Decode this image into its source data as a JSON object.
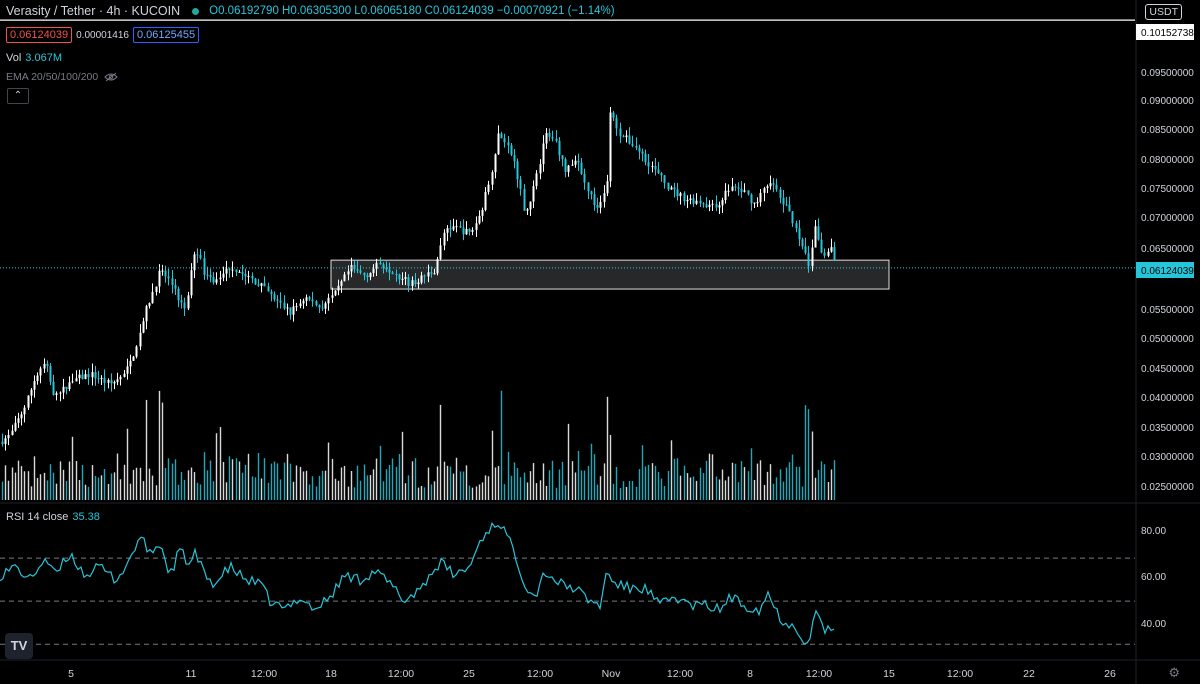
{
  "header": {
    "symbol": "Verasity / Tether · 4h · KUCOIN",
    "ohlc_text": "O0.06192790 H0.06305300 L0.06065180 C0.06124039 −0.00070921 (−1.14%)",
    "sell_price": "0.06124039",
    "spread": "0.00001416",
    "buy_price": "0.06125455",
    "vol_label": "Vol",
    "vol_value": "3.067M",
    "ema_label": "EMA 20/50/100/200",
    "rsi_label": "RSI 14 close",
    "rsi_value": "35.38",
    "currency_button": "USDT",
    "collapse_icon": "chevron-up-icon",
    "logo_text": "TV"
  },
  "colors": {
    "background": "#000000",
    "candle_up": "#ffffff",
    "candle_down": "#26c6da",
    "volume": "#ffffff",
    "rsi_line": "#26c6da",
    "current_price_tag": "#26c6da",
    "box_fill": "#b2b5be",
    "text": "#d1d4dc"
  },
  "chart_data": [
    {
      "type": "candlestick",
      "title": "Verasity / Tether · 4h · KUCOIN",
      "y_axis_labels": [
        "0.10152738",
        "0.09500000",
        "0.09000000",
        "0.08500000",
        "0.08000000",
        "0.07500000",
        "0.07000000",
        "0.06500000",
        "0.06124039",
        "0.05500000",
        "0.05000000",
        "0.04500000",
        "0.04000000",
        "0.03500000",
        "0.03000000",
        "0.02500000"
      ],
      "x_axis_labels": [
        "5",
        "11",
        "12:00",
        "18",
        "12:00",
        "25",
        "12:00",
        "Nov",
        "12:00",
        "8",
        "12:00",
        "15",
        "12:00",
        "22",
        "26"
      ],
      "ylim": [
        0.0235,
        0.1035
      ],
      "horizontal_line_price": 0.10152738,
      "current_price": 0.06124039,
      "current_price_label": "0.06124039",
      "highlight_box_price_range": [
        0.0578,
        0.0625
      ],
      "price_anchors": [
        [
          0,
          0.033
        ],
        [
          10,
          0.034
        ],
        [
          25,
          0.0388
        ],
        [
          35,
          0.0435
        ],
        [
          45,
          0.0458
        ],
        [
          55,
          0.04
        ],
        [
          70,
          0.0428
        ],
        [
          90,
          0.044
        ],
        [
          110,
          0.0423
        ],
        [
          125,
          0.044
        ],
        [
          135,
          0.048
        ],
        [
          145,
          0.054
        ],
        [
          160,
          0.0608
        ],
        [
          170,
          0.059
        ],
        [
          185,
          0.054
        ],
        [
          195,
          0.065
        ],
        [
          205,
          0.06
        ],
        [
          215,
          0.059
        ],
        [
          230,
          0.0615
        ],
        [
          245,
          0.06
        ],
        [
          260,
          0.0585
        ],
        [
          275,
          0.056
        ],
        [
          290,
          0.054
        ],
        [
          305,
          0.0565
        ],
        [
          320,
          0.0548
        ],
        [
          335,
          0.057
        ],
        [
          350,
          0.0612
        ],
        [
          365,
          0.06
        ],
        [
          380,
          0.062
        ],
        [
          395,
          0.0605
        ],
        [
          410,
          0.0585
        ],
        [
          420,
          0.0595
        ],
        [
          435,
          0.061
        ],
        [
          445,
          0.0678
        ],
        [
          455,
          0.0678
        ],
        [
          470,
          0.0668
        ],
        [
          480,
          0.07
        ],
        [
          490,
          0.076
        ],
        [
          498,
          0.083
        ],
        [
          505,
          0.082
        ],
        [
          515,
          0.078
        ],
        [
          525,
          0.07
        ],
        [
          535,
          0.075
        ],
        [
          545,
          0.083
        ],
        [
          555,
          0.082
        ],
        [
          565,
          0.077
        ],
        [
          575,
          0.079
        ],
        [
          585,
          0.075
        ],
        [
          597,
          0.0705
        ],
        [
          607,
          0.075
        ],
        [
          610,
          0.0865
        ],
        [
          620,
          0.083
        ],
        [
          635,
          0.081
        ],
        [
          650,
          0.078
        ],
        [
          660,
          0.076
        ],
        [
          670,
          0.074
        ],
        [
          685,
          0.0725
        ],
        [
          700,
          0.072
        ],
        [
          715,
          0.071
        ],
        [
          730,
          0.0745
        ],
        [
          745,
          0.0735
        ],
        [
          755,
          0.0715
        ],
        [
          770,
          0.0755
        ],
        [
          780,
          0.0725
        ],
        [
          790,
          0.07
        ],
        [
          800,
          0.066
        ],
        [
          808,
          0.0615
        ],
        [
          815,
          0.068
        ],
        [
          822,
          0.063
        ],
        [
          830,
          0.0645
        ],
        [
          836,
          0.0612
        ]
      ],
      "volume_spike_x": [
        145,
        160,
        440,
        500,
        607,
        807
      ]
    },
    {
      "type": "line",
      "title": "RSI 14 close",
      "y_axis_labels": [
        "80.00",
        "60.00",
        "40.00"
      ],
      "ylim": [
        25,
        90
      ],
      "reference_lines": [
        70,
        50,
        30
      ],
      "rsi_anchors": [
        [
          0,
          62
        ],
        [
          15,
          66
        ],
        [
          30,
          60
        ],
        [
          45,
          70
        ],
        [
          55,
          62
        ],
        [
          70,
          72
        ],
        [
          85,
          62
        ],
        [
          100,
          66
        ],
        [
          115,
          60
        ],
        [
          125,
          65
        ],
        [
          140,
          80
        ],
        [
          150,
          72
        ],
        [
          160,
          77
        ],
        [
          170,
          62
        ],
        [
          180,
          74
        ],
        [
          190,
          66
        ],
        [
          195,
          72
        ],
        [
          205,
          62
        ],
        [
          215,
          58
        ],
        [
          230,
          66
        ],
        [
          245,
          60
        ],
        [
          260,
          58
        ],
        [
          270,
          50
        ],
        [
          285,
          46
        ],
        [
          300,
          52
        ],
        [
          315,
          46
        ],
        [
          330,
          52
        ],
        [
          345,
          62
        ],
        [
          360,
          60
        ],
        [
          375,
          64
        ],
        [
          390,
          58
        ],
        [
          405,
          50
        ],
        [
          420,
          56
        ],
        [
          440,
          68
        ],
        [
          455,
          62
        ],
        [
          470,
          66
        ],
        [
          480,
          78
        ],
        [
          490,
          84
        ],
        [
          500,
          87
        ],
        [
          515,
          72
        ],
        [
          525,
          58
        ],
        [
          535,
          52
        ],
        [
          545,
          64
        ],
        [
          560,
          58
        ],
        [
          575,
          56
        ],
        [
          590,
          50
        ],
        [
          600,
          48
        ],
        [
          607,
          64
        ],
        [
          615,
          58
        ],
        [
          630,
          56
        ],
        [
          645,
          56
        ],
        [
          660,
          48
        ],
        [
          675,
          52
        ],
        [
          690,
          48
        ],
        [
          705,
          48
        ],
        [
          720,
          46
        ],
        [
          730,
          52
        ],
        [
          745,
          48
        ],
        [
          760,
          46
        ],
        [
          768,
          54
        ],
        [
          780,
          42
        ],
        [
          795,
          38
        ],
        [
          808,
          30
        ],
        [
          816,
          45
        ],
        [
          825,
          37
        ],
        [
          836,
          35
        ]
      ]
    }
  ]
}
